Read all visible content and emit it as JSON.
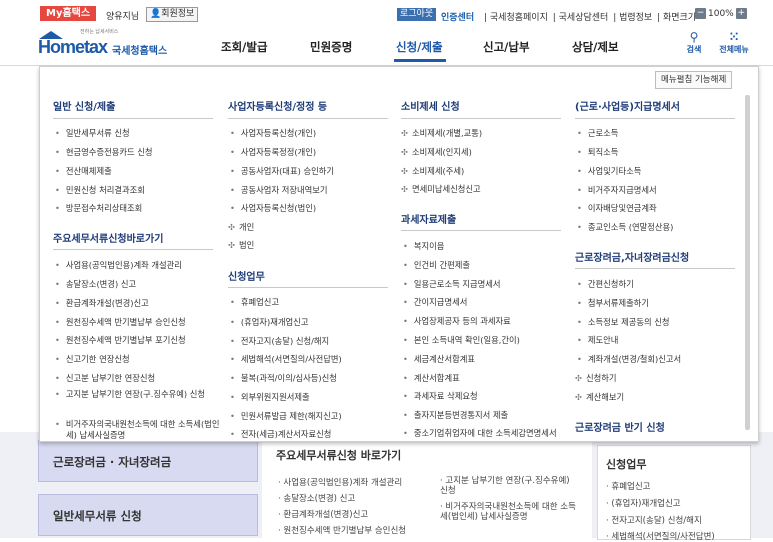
{
  "topbar": {
    "my_tab": "My홈택스",
    "user_name": "양유지님",
    "member_info": "회원정보",
    "logout": "로그아웃",
    "cert_center": "인증센터",
    "links": [
      "| 국세청홈페이지",
      "| 국세상담센터",
      "| 법령정보",
      "| 화면크기"
    ],
    "zoom": "100%"
  },
  "header": {
    "logo_small": "전하는 납세서비스",
    "logo_home": "Hometax",
    "logo_name": "국세청홈택스",
    "nav": [
      "조회/발급",
      "민원증명",
      "신청/제출",
      "신고/납부",
      "상담/제보"
    ],
    "search": "검색",
    "all_menu": "전체메뉴"
  },
  "colors": {
    "accent": "#1e5aa8",
    "my_tab": "#e6473e"
  },
  "mega": {
    "unpin": "메뉴펼침 기능해제",
    "col1": {
      "title1": "일반 신청/제출",
      "items1": [
        "일반세무서류 신청",
        "현금영수증전용카드 신청",
        "전산매체제출",
        "민원신청 처리결과조회",
        "방문접수처리상태조회"
      ],
      "title2": "주요세무서류신청바로가기",
      "items2": [
        "사업용(공익법인용)계좌 개설관리",
        "송달장소(변경) 신고",
        "환급계좌개설(변경)신고",
        "원천징수세액 반기별납부 승인신청",
        "원천징수세액 반기별납부 포기신청",
        "신고기한 연장신청",
        "신고분 납부기한 연장신청",
        "고지분 납부기한 연장(구.징수유예) 신청",
        "비거주자의국내원천소득에 대한 소득세(법인세) 납세사실증명"
      ]
    },
    "col2": {
      "title1": "사업자등록신청/정정 등",
      "items1": [
        "사업자등록신청(개인)",
        "사업자등록정정(개인)",
        "공동사업자(대표) 승인하기",
        "공동사업자 저장내역보기",
        "사업자등록신청(법인)"
      ],
      "plus1": [
        "개인",
        "법인"
      ],
      "title2": "신청업무",
      "items2": [
        "휴폐업신고",
        "(휴업자)재개업신고",
        "전자고지(송달) 신청/해지",
        "세법해석(서면질의/사전답변)",
        "불복(과적/이의/심사등)신청",
        "외부위원지원서제출",
        "민원서류발급 제한(해지신고)",
        "전자(세금)계산서자료신청"
      ]
    },
    "col3": {
      "title1": "소비제세 신청",
      "plus1": [
        "소비제세(개별,교통)",
        "소비제세(인지세)",
        "소비제세(주세)",
        "면세미납세신청신고"
      ],
      "title2": "과세자료제출",
      "items2": [
        "복지이음",
        "인건비 간편제출",
        "일용근로소득 지급명세서",
        "간이지급명세서",
        "사업장제공자 등의 과세자료",
        "본인 소득내역 확인(일용,간이)",
        "세금계산서합계표",
        "계산서합계표",
        "과세자료 삭제요청",
        "출자지분등변경통지서 제출",
        "중소기업취업자에 대한 소득세감면명세서"
      ]
    },
    "col4": {
      "title1": "(근로·사업등)지급명세서",
      "items1": [
        "근로소득",
        "퇴직소득",
        "사업및기타소득",
        "비거주자지급명세서",
        "이자배당및연금계좌",
        "종교인소득 (연말정산용)"
      ],
      "title2": "근로장려금,자녀장려금신청",
      "items2": [
        "간편신청하기",
        "첨부서류제출하기",
        "소득정보 제공동의 신청",
        "제도안내",
        "계좌개설(변경/철회)신고서"
      ],
      "plus2": [
        "신청하기",
        "계산해보기"
      ],
      "title3": "근로장려금 반기 신청"
    }
  },
  "background": {
    "card1": "근로장려금 · 자녀장려금",
    "card2": "일반세무서류 신청",
    "panel_title": "주요세무서류신청 바로가기",
    "panel_left": [
      "사업용(공익법인용)계좌 개설관리",
      "송달장소(변경) 신고",
      "환급계좌개설(변경)신고",
      "원천징수세액 반기별납부 승인신청"
    ],
    "panel_right": [
      "고지분 납부기한 연장(구.징수유예) 신청",
      "비거주자의국내원천소득에 대한 소득세(법인세) 납세사실증명"
    ],
    "right_title": "신청업무",
    "right_items": [
      "휴폐업신고",
      "(휴업자)재개업신고",
      "전자고지(송달) 신청/해지",
      "세법해석(서면질의/사전답변)"
    ]
  }
}
